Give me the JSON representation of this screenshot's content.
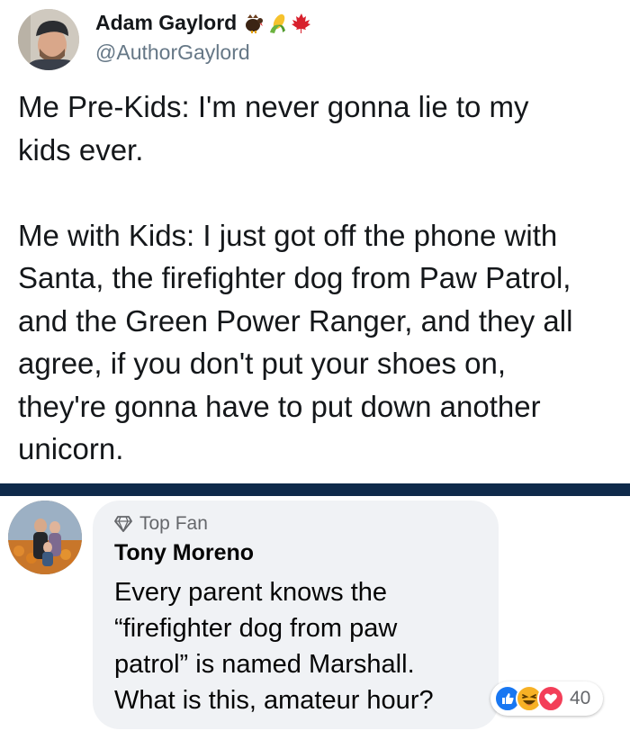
{
  "tweet": {
    "author_name": "Adam Gaylord",
    "handle": "@AuthorGaylord",
    "name_emojis": [
      "turkey-icon",
      "corn-icon",
      "maple-leaf-icon"
    ],
    "text": "Me Pre-Kids: I'm never gonna lie to my\nkids ever.\n\nMe with Kids: I just got off the phone with\nSanta, the firefighter dog from Paw Patrol,\nand the Green Power Ranger, and they all\nagree, if you don't put your shoes on,\nthey're gonna have to put down another\nunicorn."
  },
  "comment": {
    "badge_icon": "diamond-icon",
    "badge_label": "Top Fan",
    "author_name": "Tony Moreno",
    "text": "Every parent knows the\n“firefighter dog from paw\npatrol” is named Marshall.\nWhat is this, amateur hour?",
    "reactions": [
      "like-icon",
      "haha-icon",
      "love-icon"
    ],
    "reaction_count": "40"
  },
  "colors": {
    "divider": "#0f2a4a",
    "bubble": "#f0f2f5",
    "like": "#1877f2",
    "love": "#f33e58",
    "haha": "#f7b125"
  }
}
